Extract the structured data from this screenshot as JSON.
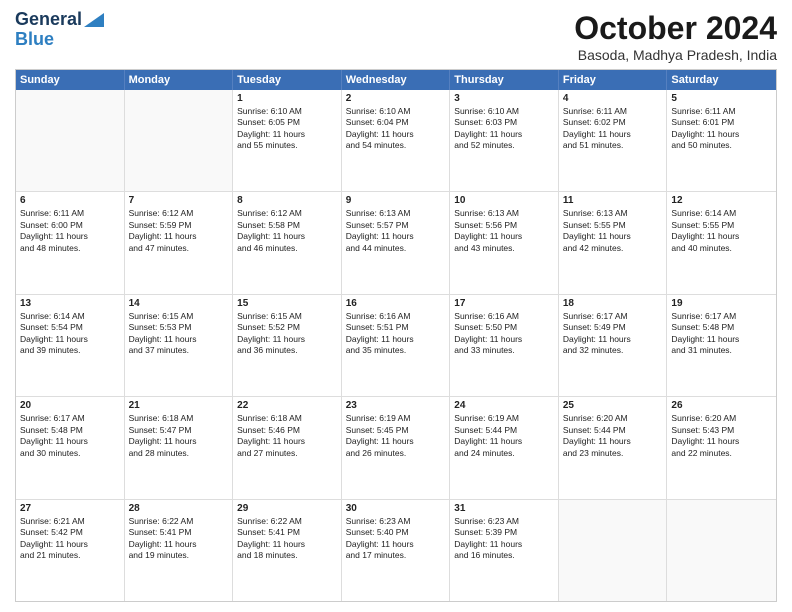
{
  "header": {
    "logo_general": "General",
    "logo_blue": "Blue",
    "month_title": "October 2024",
    "location": "Basoda, Madhya Pradesh, India"
  },
  "days_of_week": [
    "Sunday",
    "Monday",
    "Tuesday",
    "Wednesday",
    "Thursday",
    "Friday",
    "Saturday"
  ],
  "rows": [
    [
      {
        "day": "",
        "empty": true,
        "lines": []
      },
      {
        "day": "",
        "empty": true,
        "lines": []
      },
      {
        "day": "1",
        "empty": false,
        "lines": [
          "Sunrise: 6:10 AM",
          "Sunset: 6:05 PM",
          "Daylight: 11 hours",
          "and 55 minutes."
        ]
      },
      {
        "day": "2",
        "empty": false,
        "lines": [
          "Sunrise: 6:10 AM",
          "Sunset: 6:04 PM",
          "Daylight: 11 hours",
          "and 54 minutes."
        ]
      },
      {
        "day": "3",
        "empty": false,
        "lines": [
          "Sunrise: 6:10 AM",
          "Sunset: 6:03 PM",
          "Daylight: 11 hours",
          "and 52 minutes."
        ]
      },
      {
        "day": "4",
        "empty": false,
        "lines": [
          "Sunrise: 6:11 AM",
          "Sunset: 6:02 PM",
          "Daylight: 11 hours",
          "and 51 minutes."
        ]
      },
      {
        "day": "5",
        "empty": false,
        "lines": [
          "Sunrise: 6:11 AM",
          "Sunset: 6:01 PM",
          "Daylight: 11 hours",
          "and 50 minutes."
        ]
      }
    ],
    [
      {
        "day": "6",
        "empty": false,
        "lines": [
          "Sunrise: 6:11 AM",
          "Sunset: 6:00 PM",
          "Daylight: 11 hours",
          "and 48 minutes."
        ]
      },
      {
        "day": "7",
        "empty": false,
        "lines": [
          "Sunrise: 6:12 AM",
          "Sunset: 5:59 PM",
          "Daylight: 11 hours",
          "and 47 minutes."
        ]
      },
      {
        "day": "8",
        "empty": false,
        "lines": [
          "Sunrise: 6:12 AM",
          "Sunset: 5:58 PM",
          "Daylight: 11 hours",
          "and 46 minutes."
        ]
      },
      {
        "day": "9",
        "empty": false,
        "lines": [
          "Sunrise: 6:13 AM",
          "Sunset: 5:57 PM",
          "Daylight: 11 hours",
          "and 44 minutes."
        ]
      },
      {
        "day": "10",
        "empty": false,
        "lines": [
          "Sunrise: 6:13 AM",
          "Sunset: 5:56 PM",
          "Daylight: 11 hours",
          "and 43 minutes."
        ]
      },
      {
        "day": "11",
        "empty": false,
        "lines": [
          "Sunrise: 6:13 AM",
          "Sunset: 5:55 PM",
          "Daylight: 11 hours",
          "and 42 minutes."
        ]
      },
      {
        "day": "12",
        "empty": false,
        "lines": [
          "Sunrise: 6:14 AM",
          "Sunset: 5:55 PM",
          "Daylight: 11 hours",
          "and 40 minutes."
        ]
      }
    ],
    [
      {
        "day": "13",
        "empty": false,
        "lines": [
          "Sunrise: 6:14 AM",
          "Sunset: 5:54 PM",
          "Daylight: 11 hours",
          "and 39 minutes."
        ]
      },
      {
        "day": "14",
        "empty": false,
        "lines": [
          "Sunrise: 6:15 AM",
          "Sunset: 5:53 PM",
          "Daylight: 11 hours",
          "and 37 minutes."
        ]
      },
      {
        "day": "15",
        "empty": false,
        "lines": [
          "Sunrise: 6:15 AM",
          "Sunset: 5:52 PM",
          "Daylight: 11 hours",
          "and 36 minutes."
        ]
      },
      {
        "day": "16",
        "empty": false,
        "lines": [
          "Sunrise: 6:16 AM",
          "Sunset: 5:51 PM",
          "Daylight: 11 hours",
          "and 35 minutes."
        ]
      },
      {
        "day": "17",
        "empty": false,
        "lines": [
          "Sunrise: 6:16 AM",
          "Sunset: 5:50 PM",
          "Daylight: 11 hours",
          "and 33 minutes."
        ]
      },
      {
        "day": "18",
        "empty": false,
        "lines": [
          "Sunrise: 6:17 AM",
          "Sunset: 5:49 PM",
          "Daylight: 11 hours",
          "and 32 minutes."
        ]
      },
      {
        "day": "19",
        "empty": false,
        "lines": [
          "Sunrise: 6:17 AM",
          "Sunset: 5:48 PM",
          "Daylight: 11 hours",
          "and 31 minutes."
        ]
      }
    ],
    [
      {
        "day": "20",
        "empty": false,
        "lines": [
          "Sunrise: 6:17 AM",
          "Sunset: 5:48 PM",
          "Daylight: 11 hours",
          "and 30 minutes."
        ]
      },
      {
        "day": "21",
        "empty": false,
        "lines": [
          "Sunrise: 6:18 AM",
          "Sunset: 5:47 PM",
          "Daylight: 11 hours",
          "and 28 minutes."
        ]
      },
      {
        "day": "22",
        "empty": false,
        "lines": [
          "Sunrise: 6:18 AM",
          "Sunset: 5:46 PM",
          "Daylight: 11 hours",
          "and 27 minutes."
        ]
      },
      {
        "day": "23",
        "empty": false,
        "lines": [
          "Sunrise: 6:19 AM",
          "Sunset: 5:45 PM",
          "Daylight: 11 hours",
          "and 26 minutes."
        ]
      },
      {
        "day": "24",
        "empty": false,
        "lines": [
          "Sunrise: 6:19 AM",
          "Sunset: 5:44 PM",
          "Daylight: 11 hours",
          "and 24 minutes."
        ]
      },
      {
        "day": "25",
        "empty": false,
        "lines": [
          "Sunrise: 6:20 AM",
          "Sunset: 5:44 PM",
          "Daylight: 11 hours",
          "and 23 minutes."
        ]
      },
      {
        "day": "26",
        "empty": false,
        "lines": [
          "Sunrise: 6:20 AM",
          "Sunset: 5:43 PM",
          "Daylight: 11 hours",
          "and 22 minutes."
        ]
      }
    ],
    [
      {
        "day": "27",
        "empty": false,
        "lines": [
          "Sunrise: 6:21 AM",
          "Sunset: 5:42 PM",
          "Daylight: 11 hours",
          "and 21 minutes."
        ]
      },
      {
        "day": "28",
        "empty": false,
        "lines": [
          "Sunrise: 6:22 AM",
          "Sunset: 5:41 PM",
          "Daylight: 11 hours",
          "and 19 minutes."
        ]
      },
      {
        "day": "29",
        "empty": false,
        "lines": [
          "Sunrise: 6:22 AM",
          "Sunset: 5:41 PM",
          "Daylight: 11 hours",
          "and 18 minutes."
        ]
      },
      {
        "day": "30",
        "empty": false,
        "lines": [
          "Sunrise: 6:23 AM",
          "Sunset: 5:40 PM",
          "Daylight: 11 hours",
          "and 17 minutes."
        ]
      },
      {
        "day": "31",
        "empty": false,
        "lines": [
          "Sunrise: 6:23 AM",
          "Sunset: 5:39 PM",
          "Daylight: 11 hours",
          "and 16 minutes."
        ]
      },
      {
        "day": "",
        "empty": true,
        "lines": []
      },
      {
        "day": "",
        "empty": true,
        "lines": []
      }
    ]
  ]
}
